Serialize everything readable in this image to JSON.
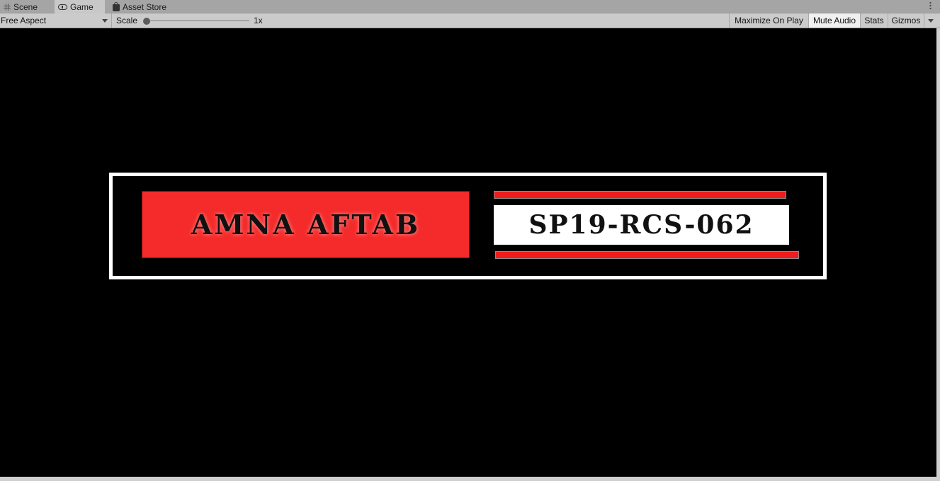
{
  "tabs": [
    {
      "label": "Scene",
      "icon": "grid-icon"
    },
    {
      "label": "Game",
      "icon": "gamepad-icon",
      "active": true
    },
    {
      "label": "Asset Store",
      "icon": "shopping-bag-icon"
    }
  ],
  "toolbar": {
    "aspect_value": "Free Aspect",
    "scale_label": "Scale",
    "scale_value": "1x",
    "maximize_label": "Maximize On Play",
    "mute_label": "Mute Audio",
    "stats_label": "Stats",
    "gizmos_label": "Gizmos"
  },
  "game": {
    "name_text": "AMNA AFTAB",
    "id_text": "SP19-RCS-062",
    "colors": {
      "background": "#000000",
      "frame": "#ffffff",
      "name_box": "#f52a2a",
      "bars": "#ee1c1c",
      "id_box": "#ffffff"
    }
  }
}
